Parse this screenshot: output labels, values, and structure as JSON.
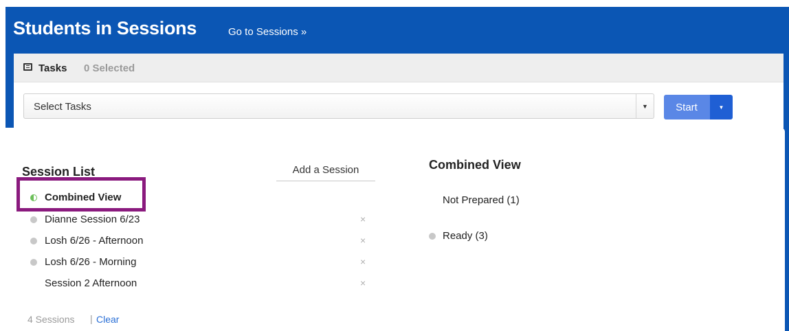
{
  "header": {
    "title": "Students in Sessions",
    "go_link": "Go to Sessions »"
  },
  "tasks": {
    "label": "Tasks",
    "selected_count": "0 Selected",
    "select_placeholder": "Select Tasks",
    "start_label": "Start"
  },
  "session_list": {
    "title": "Session List",
    "add_button": "Add a Session",
    "items": [
      {
        "label": "Combined View",
        "dot": "half-green",
        "removable": false
      },
      {
        "label": "Dianne Session 6/23",
        "dot": "gray",
        "removable": true
      },
      {
        "label": "Losh 6/26 - Afternoon",
        "dot": "gray",
        "removable": true
      },
      {
        "label": "Losh 6/26 - Morning",
        "dot": "gray",
        "removable": true
      },
      {
        "label": "Session 2 Afternoon",
        "dot": "none",
        "removable": true
      }
    ],
    "remove_glyph": "×",
    "footer_count": "4 Sessions",
    "footer_separator": "|",
    "clear_label": "Clear"
  },
  "combined_view": {
    "title": "Combined View",
    "groups": [
      {
        "label": "Not Prepared (1)",
        "dot": "none"
      },
      {
        "label": "Ready (3)",
        "dot": "gray"
      }
    ]
  },
  "colors": {
    "brand_blue": "#0b56b4",
    "start_button": "#5a87e6",
    "highlight": "#8a1a7e",
    "link": "#2a6fd6"
  }
}
